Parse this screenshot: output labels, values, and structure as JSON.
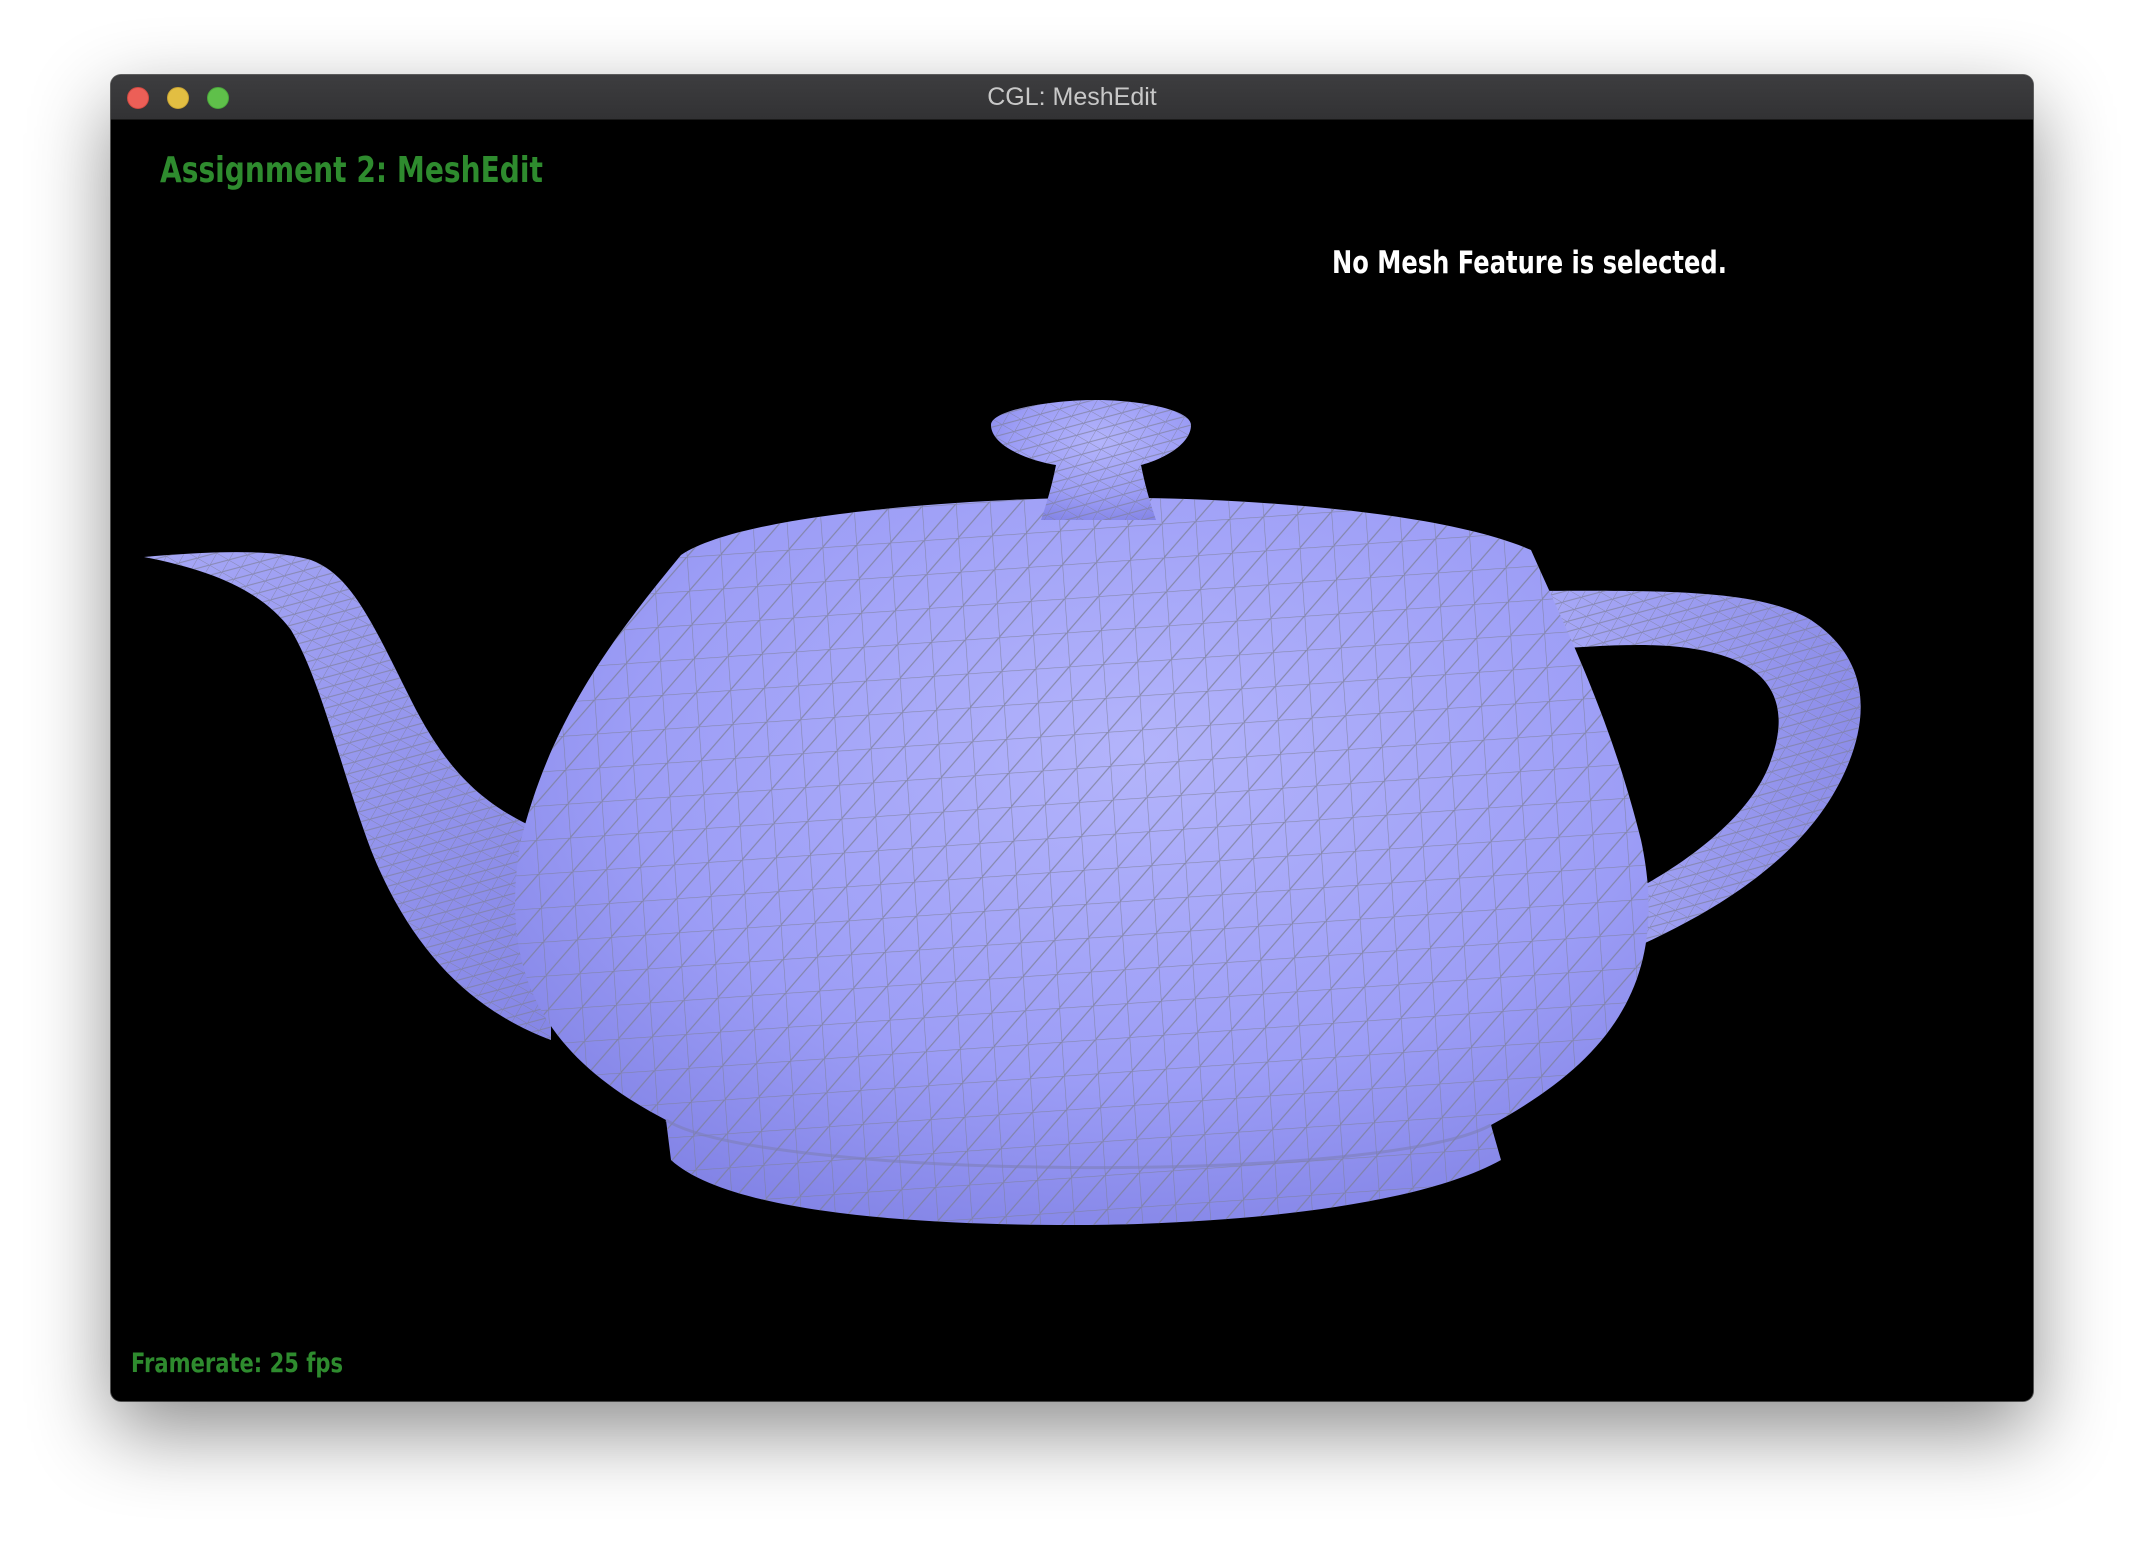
{
  "window": {
    "title": "CGL: MeshEdit"
  },
  "viewport": {
    "heading": "Assignment 2: MeshEdit",
    "selection_status": "No Mesh Feature is selected.",
    "framerate": "Framerate: 25 fps",
    "model": "teapot-mesh",
    "colors": {
      "background": "#000000",
      "mesh_fill": "#9d9cf5",
      "mesh_wire": "#8a8a9a",
      "heading_text": "#2e8b2e",
      "status_text": "#ffffff"
    }
  }
}
